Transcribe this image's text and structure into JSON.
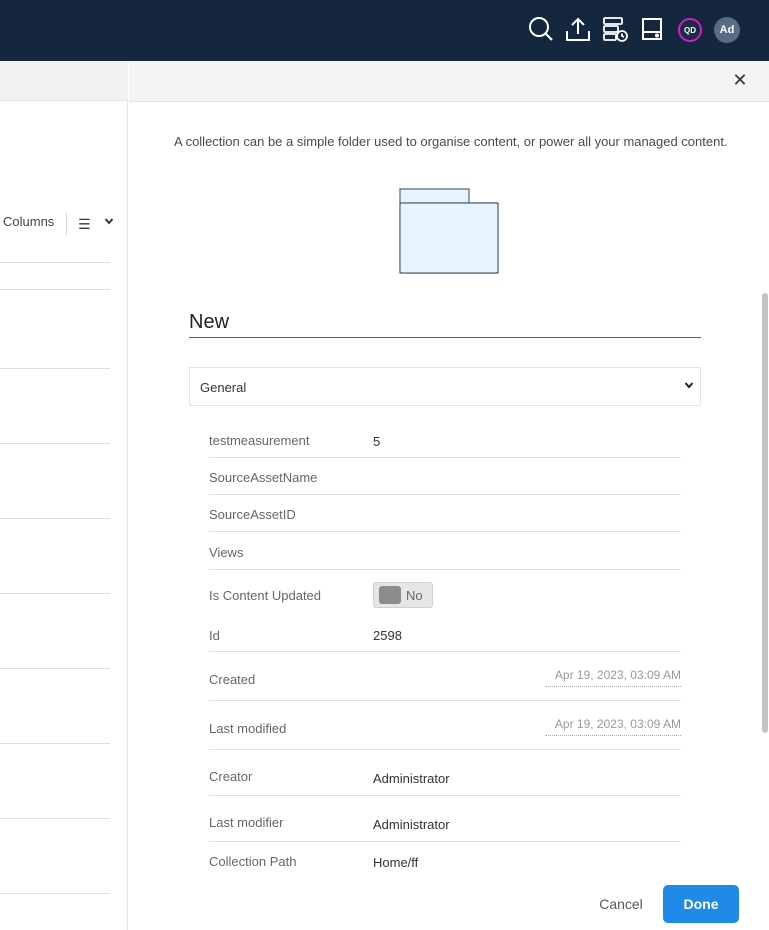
{
  "header": {
    "icons": [
      "search-icon",
      "upload-icon",
      "database-clock-icon",
      "drive-icon"
    ],
    "avatar_qd": "QD",
    "avatar_admin": "Ad"
  },
  "left_panel": {
    "columns_label": "Columns"
  },
  "dialog": {
    "description": "A collection can be a simple folder used to organise content, or power all your managed content.",
    "name_value": "New",
    "type_selected": "General",
    "fields": [
      {
        "label": "testmeasurement",
        "value": "5"
      },
      {
        "label": "SourceAssetName",
        "value": ""
      },
      {
        "label": "SourceAssetID",
        "value": ""
      },
      {
        "label": "Views",
        "value": ""
      },
      {
        "label": "Is Content Updated",
        "value": "No"
      },
      {
        "label": "Id",
        "value": "2598"
      },
      {
        "label": "Created",
        "value": "Apr 19, 2023, 03:09 AM"
      },
      {
        "label": "Last modified",
        "value": "Apr 19, 2023, 03:09 AM"
      },
      {
        "label": "Creator",
        "value": "Administrator"
      },
      {
        "label": "Last modifier",
        "value": "Administrator"
      },
      {
        "label": "Collection Path",
        "value": "Home/ff"
      }
    ],
    "cancel_label": "Cancel",
    "done_label": "Done"
  },
  "colors": {
    "topbar": "#15263f",
    "accent": "#1f8ae8",
    "avatar_ring": "#d21fbf",
    "folder_fill": "#e8f4fd",
    "folder_stroke": "#55657a"
  }
}
